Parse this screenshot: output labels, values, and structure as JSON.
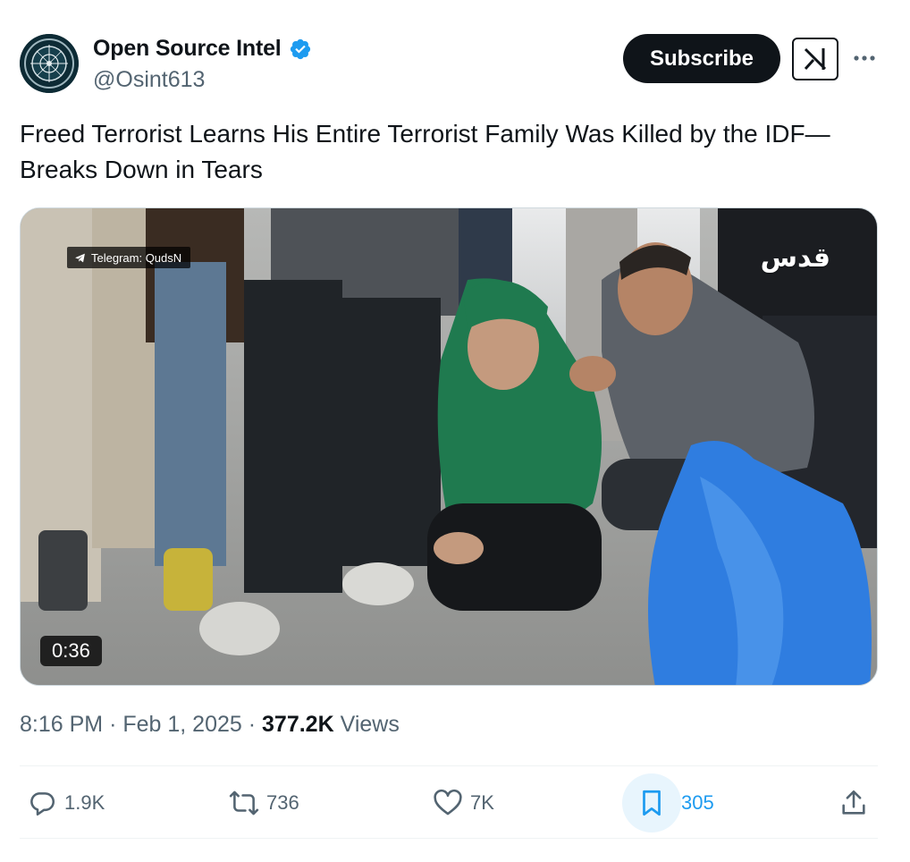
{
  "author": {
    "display_name": "Open Source Intel",
    "handle": "@Osint613",
    "verified_icon": "verified-badge-icon",
    "avatar_icon": "osint-logo-avatar"
  },
  "header": {
    "subscribe_label": "Subscribe",
    "grok_icon": "grok-icon",
    "more_icon": "more-dots-icon"
  },
  "tweet": {
    "text_line1": "Freed Terrorist Learns His Entire Terrorist Family Was Killed by the IDF—",
    "text_line2": "Breaks Down in Tears"
  },
  "media": {
    "watermark_label": "Telegram: QudsN",
    "channel_logo": "قدس",
    "duration": "0:36"
  },
  "meta": {
    "time": "8:16 PM",
    "separator": "·",
    "date": "Feb 1, 2025",
    "views_count": "377.2K",
    "views_label": "Views"
  },
  "actions": {
    "replies": "1.9K",
    "reposts": "736",
    "likes": "7K",
    "bookmarks": "305"
  },
  "colors": {
    "text_primary": "#0f1419",
    "text_secondary": "#536471",
    "accent": "#1d9bf0",
    "subscribe_bg": "#0f1419",
    "bookmark_highlight": "#e8f5fd"
  }
}
